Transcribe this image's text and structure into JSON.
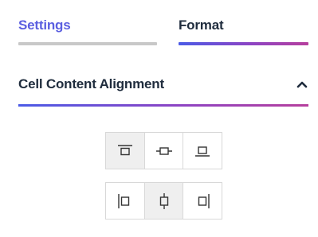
{
  "tabs": [
    {
      "label": "Settings",
      "active": false
    },
    {
      "label": "Format",
      "active": true
    }
  ],
  "section": {
    "title": "Cell Content Alignment",
    "expanded": true,
    "toggle_icon": "chevron-up-icon"
  },
  "vertical_alignment": {
    "selected": "top",
    "options": [
      {
        "value": "top",
        "icon": "align-top-icon"
      },
      {
        "value": "middle",
        "icon": "align-middle-icon"
      },
      {
        "value": "bottom",
        "icon": "align-bottom-icon"
      }
    ]
  },
  "horizontal_alignment": {
    "selected": "center",
    "options": [
      {
        "value": "left",
        "icon": "align-left-icon"
      },
      {
        "value": "center",
        "icon": "align-center-icon"
      },
      {
        "value": "right",
        "icon": "align-right-icon"
      }
    ]
  },
  "colors": {
    "settings_tab_text": "#5b5fe0",
    "format_tab_text": "#1f2c3d",
    "accent_gradient_start": "#4b5be6",
    "accent_gradient_end": "#b63f9d",
    "inactive_bar": "#c8c8c8",
    "selected_button_bg": "#efefef"
  }
}
